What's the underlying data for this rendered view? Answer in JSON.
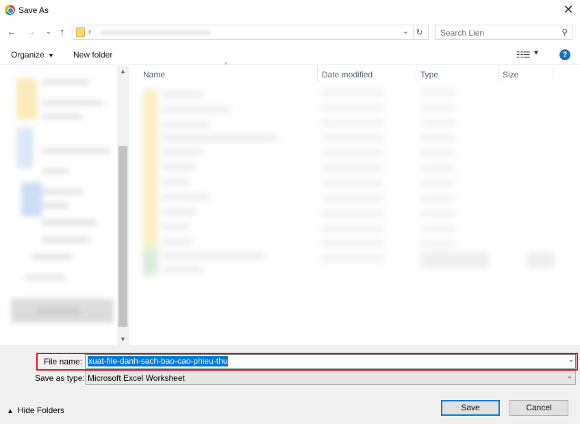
{
  "window": {
    "title": "Save As",
    "close_icon": "close-icon"
  },
  "nav": {
    "back_icon": "arrow-left-icon",
    "forward_icon": "arrow-right-icon",
    "recent_icon": "chevron-down-icon",
    "up_icon": "arrow-up-icon",
    "search_placeholder": "Search Lien"
  },
  "toolbar": {
    "organize": "Organize",
    "new_folder": "New folder",
    "help": "?"
  },
  "columns": {
    "name": "Name",
    "date": "Date modified",
    "type": "Type",
    "size": "Size"
  },
  "footer": {
    "file_name_label": "File name:",
    "file_name_value": "xuat-file-danh-sach-bao-cao-phieu-thu",
    "save_type_label": "Save as type:",
    "save_type_value": "Microsoft Excel Worksheet",
    "hide_folders": "Hide Folders",
    "save": "Save",
    "cancel": "Cancel"
  },
  "colors": {
    "accent": "#0078d7",
    "highlight_border": "#e0141e",
    "help_icon": "#1c6fc6"
  }
}
